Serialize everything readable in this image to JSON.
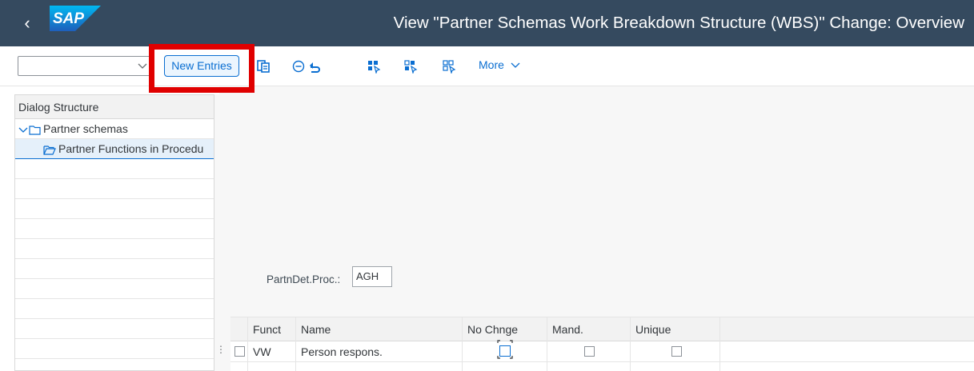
{
  "shell": {
    "back_glyph": "‹",
    "logo_text": "SAP",
    "title": "View \"Partner Schemas Work Breakdown Structure (WBS)\" Change: Overview"
  },
  "toolbar": {
    "command_field_value": "",
    "new_entries_label": "New Entries",
    "more_label": "More",
    "icons": [
      "copy-as-icon",
      "delete-icon",
      "undo-icon",
      "select-all-icon",
      "select-block-icon",
      "deselect-all-icon"
    ]
  },
  "dialog_structure": {
    "header": "Dialog Structure",
    "items": [
      {
        "label": "Partner schemas",
        "level": 0,
        "expanded": true,
        "icon": "folder-icon"
      },
      {
        "label": "Partner Functions in Procedu",
        "level": 1,
        "selected": true,
        "icon": "folder-open-icon"
      }
    ]
  },
  "main": {
    "partn_label": "PartnDet.Proc.:",
    "partn_value": "AGH"
  },
  "table": {
    "columns": [
      "Funct",
      "Name",
      "No Chnge",
      "Mand.",
      "Unique"
    ],
    "rows": [
      {
        "funct": "VW",
        "name": "Person respons.",
        "no_chnge": false,
        "mand": false,
        "unique": false
      }
    ]
  },
  "colors": {
    "shell_bg": "#354a5f",
    "accent": "#0a6ed1",
    "highlight": "#e00000"
  }
}
